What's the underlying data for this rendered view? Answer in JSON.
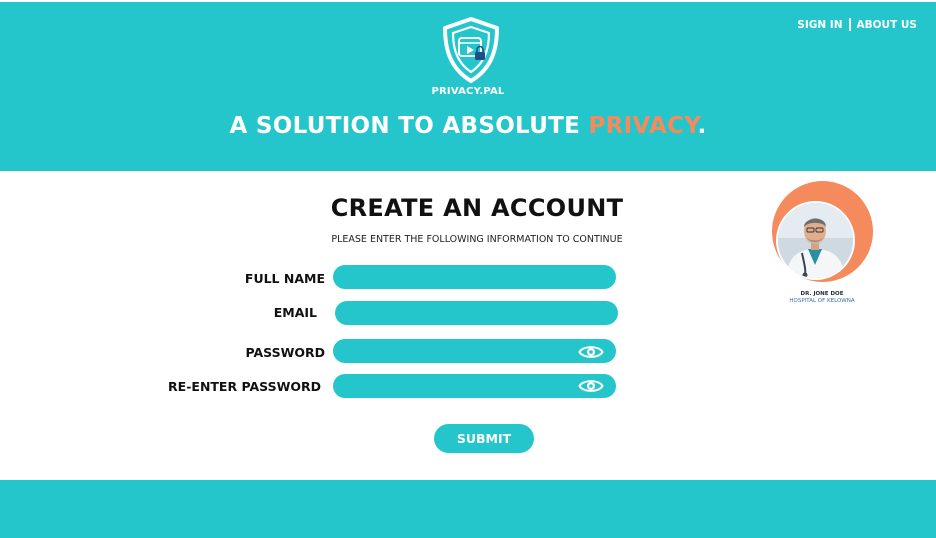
{
  "brand": {
    "name": "PRIVACY.PAL",
    "logo_icon": "shield-video-lock-icon",
    "accent_color": "#25c6cb",
    "highlight_color": "#f58a5c"
  },
  "nav": {
    "sign_in": "SIGN IN",
    "about_us": "ABOUT US"
  },
  "hero": {
    "tagline_prefix": "A SOLUTION TO ABSOLUTE ",
    "tagline_highlight": "PRIVACY",
    "tagline_suffix": "."
  },
  "form": {
    "title": "CREATE AN ACCOUNT",
    "subtitle": "PLEASE ENTER THE FOLLOWING INFORMATION TO CONTINUE",
    "fields": {
      "full_name": {
        "label": "FULL NAME",
        "value": ""
      },
      "email": {
        "label": "EMAIL",
        "value": ""
      },
      "password": {
        "label": "PASSWORD",
        "value": "",
        "icon": "eye-icon"
      },
      "reenter_password": {
        "label": "RE-ENTER PASSWORD",
        "value": "",
        "icon": "eye-icon"
      }
    },
    "submit_label": "SUBMIT"
  },
  "profile": {
    "name": "DR. JONE DOE",
    "organization": "HOSPITAL OF KELOWNA"
  }
}
